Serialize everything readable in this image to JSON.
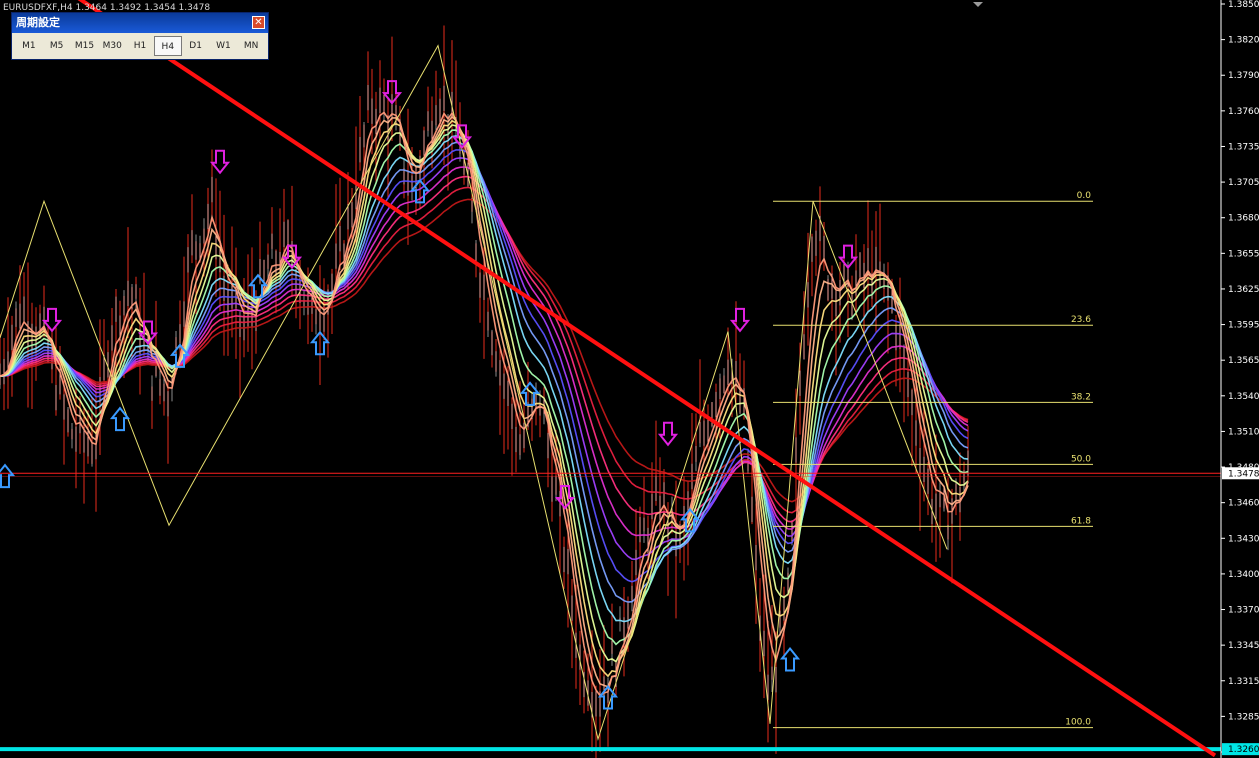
{
  "symbol_info": "EURUSDFXF,H4  1.3464 1.3492 1.3454 1.3478",
  "timeframe_panel": {
    "title": "周期設定",
    "close_icon": "close-icon",
    "buttons": [
      "M1",
      "M5",
      "M15",
      "M30",
      "H1",
      "H4",
      "D1",
      "W1",
      "MN"
    ],
    "active": "H4"
  },
  "colors": {
    "background": "#000000",
    "axis": "#ffffff",
    "trendline": "#ff1010",
    "current_price_line": "#ff2020",
    "support_line": "#00e5e5",
    "fibo": "#e8e070",
    "zigzag": "#e8e070",
    "candles": "#ff3020",
    "up_arrow": "#3a9aff",
    "down_arrow": "#e020e0"
  },
  "chart_data": {
    "type": "line",
    "price_axis": {
      "range": [
        1.3253,
        1.3852
      ],
      "ticks": [
        "1.3850",
        "1.3820",
        "1.3790",
        "1.3760",
        "1.3735",
        "1.3705",
        "1.3680",
        "1.3655",
        "1.3625",
        "1.3595",
        "1.3565",
        "1.3540",
        "1.3510",
        "1.3480",
        "1.3460",
        "1.3430",
        "1.3400",
        "1.3370",
        "1.3345",
        "1.3315",
        "1.3285",
        "1.3255"
      ],
      "current_price": "1.3478",
      "support_price": "1.3260"
    },
    "fibonacci": [
      {
        "level": "0.0",
        "price": 1.3693
      },
      {
        "level": "23.6",
        "price": 1.3595
      },
      {
        "level": "38.2",
        "price": 1.3534
      },
      {
        "level": "50.0",
        "price": 1.3485
      },
      {
        "level": "61.8",
        "price": 1.3436
      },
      {
        "level": "100.0",
        "price": 1.3277
      }
    ],
    "trendline": {
      "from": [
        -10,
        1.39
      ],
      "to": [
        1215,
        1.3255
      ]
    },
    "zigzag": [
      [
        0,
        1.3585
      ],
      [
        44,
        1.3693
      ],
      [
        169,
        1.3437
      ],
      [
        438,
        1.3816
      ],
      [
        598,
        1.3268
      ],
      [
        728,
        1.359
      ],
      [
        770,
        1.328
      ],
      [
        813,
        1.3693
      ],
      [
        947,
        1.3418
      ]
    ],
    "up_arrows": [
      [
        5,
        1.3475
      ],
      [
        120,
        1.352
      ],
      [
        180,
        1.357
      ],
      [
        258,
        1.3625
      ],
      [
        320,
        1.358
      ],
      [
        420,
        1.37
      ],
      [
        530,
        1.354
      ],
      [
        608,
        1.33
      ],
      [
        690,
        1.344
      ],
      [
        790,
        1.333
      ]
    ],
    "down_arrows": [
      [
        52,
        1.36
      ],
      [
        148,
        1.359
      ],
      [
        220,
        1.3725
      ],
      [
        292,
        1.365
      ],
      [
        392,
        1.378
      ],
      [
        462,
        1.3745
      ],
      [
        565,
        1.346
      ],
      [
        668,
        1.351
      ],
      [
        740,
        1.36
      ],
      [
        848,
        1.365
      ]
    ],
    "price_path": [
      [
        0,
        1.3555
      ],
      [
        20,
        1.361
      ],
      [
        44,
        1.3585
      ],
      [
        70,
        1.351
      ],
      [
        95,
        1.35
      ],
      [
        110,
        1.359
      ],
      [
        130,
        1.3625
      ],
      [
        150,
        1.356
      ],
      [
        169,
        1.354
      ],
      [
        190,
        1.365
      ],
      [
        212,
        1.369
      ],
      [
        225,
        1.362
      ],
      [
        245,
        1.359
      ],
      [
        268,
        1.364
      ],
      [
        290,
        1.366
      ],
      [
        310,
        1.36
      ],
      [
        330,
        1.362
      ],
      [
        350,
        1.368
      ],
      [
        370,
        1.377
      ],
      [
        392,
        1.376
      ],
      [
        412,
        1.37
      ],
      [
        438,
        1.378
      ],
      [
        460,
        1.374
      ],
      [
        480,
        1.364
      ],
      [
        500,
        1.356
      ],
      [
        520,
        1.35
      ],
      [
        540,
        1.354
      ],
      [
        560,
        1.344
      ],
      [
        580,
        1.333
      ],
      [
        598,
        1.33
      ],
      [
        615,
        1.333
      ],
      [
        640,
        1.342
      ],
      [
        660,
        1.346
      ],
      [
        680,
        1.342
      ],
      [
        700,
        1.35
      ],
      [
        715,
        1.354
      ],
      [
        728,
        1.357
      ],
      [
        745,
        1.352
      ],
      [
        760,
        1.336
      ],
      [
        770,
        1.33
      ],
      [
        790,
        1.339
      ],
      [
        800,
        1.355
      ],
      [
        813,
        1.368
      ],
      [
        830,
        1.363
      ],
      [
        850,
        1.362
      ],
      [
        870,
        1.364
      ],
      [
        890,
        1.362
      ],
      [
        910,
        1.354
      ],
      [
        930,
        1.346
      ],
      [
        947,
        1.344
      ],
      [
        968,
        1.3478
      ]
    ],
    "ma_ribbon": [
      {
        "color": "#ff9a7a",
        "lag": 1,
        "smooth": 0.4
      },
      {
        "color": "#ffb48a",
        "lag": 2,
        "smooth": 0.3
      },
      {
        "color": "#ffe080",
        "lag": 3,
        "smooth": 0.23
      },
      {
        "color": "#e8ff9a",
        "lag": 4,
        "smooth": 0.18
      },
      {
        "color": "#a8ffb0",
        "lag": 5,
        "smooth": 0.14
      },
      {
        "color": "#80e0ff",
        "lag": 6,
        "smooth": 0.11
      },
      {
        "color": "#7aa0ff",
        "lag": 7,
        "smooth": 0.09
      },
      {
        "color": "#5a50ff",
        "lag": 8,
        "smooth": 0.075
      },
      {
        "color": "#a040ff",
        "lag": 9,
        "smooth": 0.063
      },
      {
        "color": "#e030d0",
        "lag": 10,
        "smooth": 0.053
      },
      {
        "color": "#ff3080",
        "lag": 11,
        "smooth": 0.045
      },
      {
        "color": "#e82040",
        "lag": 12,
        "smooth": 0.038
      },
      {
        "color": "#c01818",
        "lag": 13,
        "smooth": 0.032
      }
    ]
  }
}
